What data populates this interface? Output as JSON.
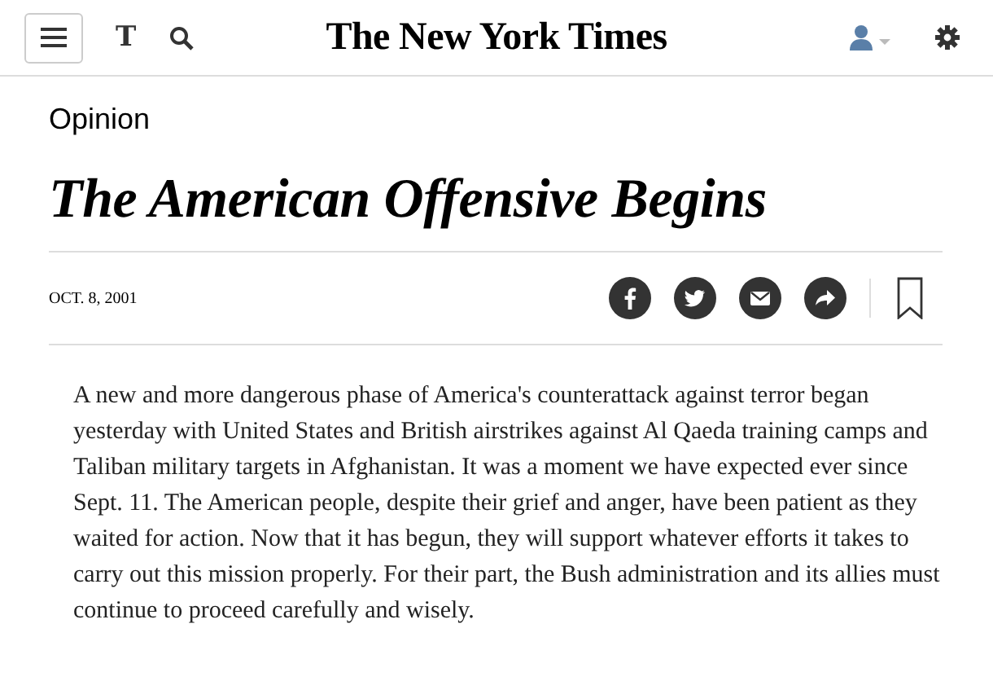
{
  "header": {
    "logo_mark": "T",
    "logo": "The New York Times"
  },
  "section": "Opinion",
  "headline": "The American Offensive Begins",
  "date": "OCT. 8, 2001",
  "share": [
    {
      "kind": "facebook"
    },
    {
      "kind": "twitter"
    },
    {
      "kind": "email"
    },
    {
      "kind": "share"
    }
  ],
  "body": "A new and more dangerous phase of America's counterattack against terror began yesterday with United States and British airstrikes against Al Qaeda training camps and Taliban military targets in Afghanistan. It was a moment we have expected ever since Sept. 11. The American people, despite their grief and anger, have been patient as they waited for action. Now that it has begun, they will support whatever efforts it takes to carry out this mission properly. For their part, the Bush administration and its allies must continue to proceed carefully and wisely."
}
